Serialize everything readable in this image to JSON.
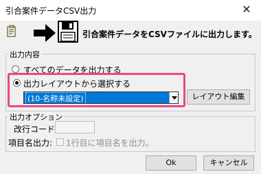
{
  "window": {
    "title": "引合案件データCSV出力",
    "close_symbol": "✕"
  },
  "header": {
    "message": "引合案件データをCSVファイルに出力します。",
    "icons": [
      "memo-icon",
      "arrow-right-icon",
      "floppy-disk-icon"
    ]
  },
  "output_content": {
    "group_label": "出力内容",
    "option_all_label": "すべてのデータを出力する",
    "option_layout_label": "出力レイアウトから選択する",
    "selected_option": "layout",
    "layout_select": {
      "value": "(10-名称未設定)"
    },
    "layout_edit_button": "レイアウト編集"
  },
  "output_options": {
    "group_label": "出力オプション",
    "newline_code_label": "改行コード:",
    "newline_code_value": "",
    "item_name_output_label": "項目名出力:",
    "item_name_checkbox_label": "1行目に項目名を出力。",
    "item_name_checked": false
  },
  "footer": {
    "ok_button": "Ok",
    "cancel_button": "キャンセル"
  },
  "colors": {
    "selection_blue": "#0078d7",
    "highlight_pink": "#e8478b",
    "dialog_bg": "#f0f0f0"
  }
}
